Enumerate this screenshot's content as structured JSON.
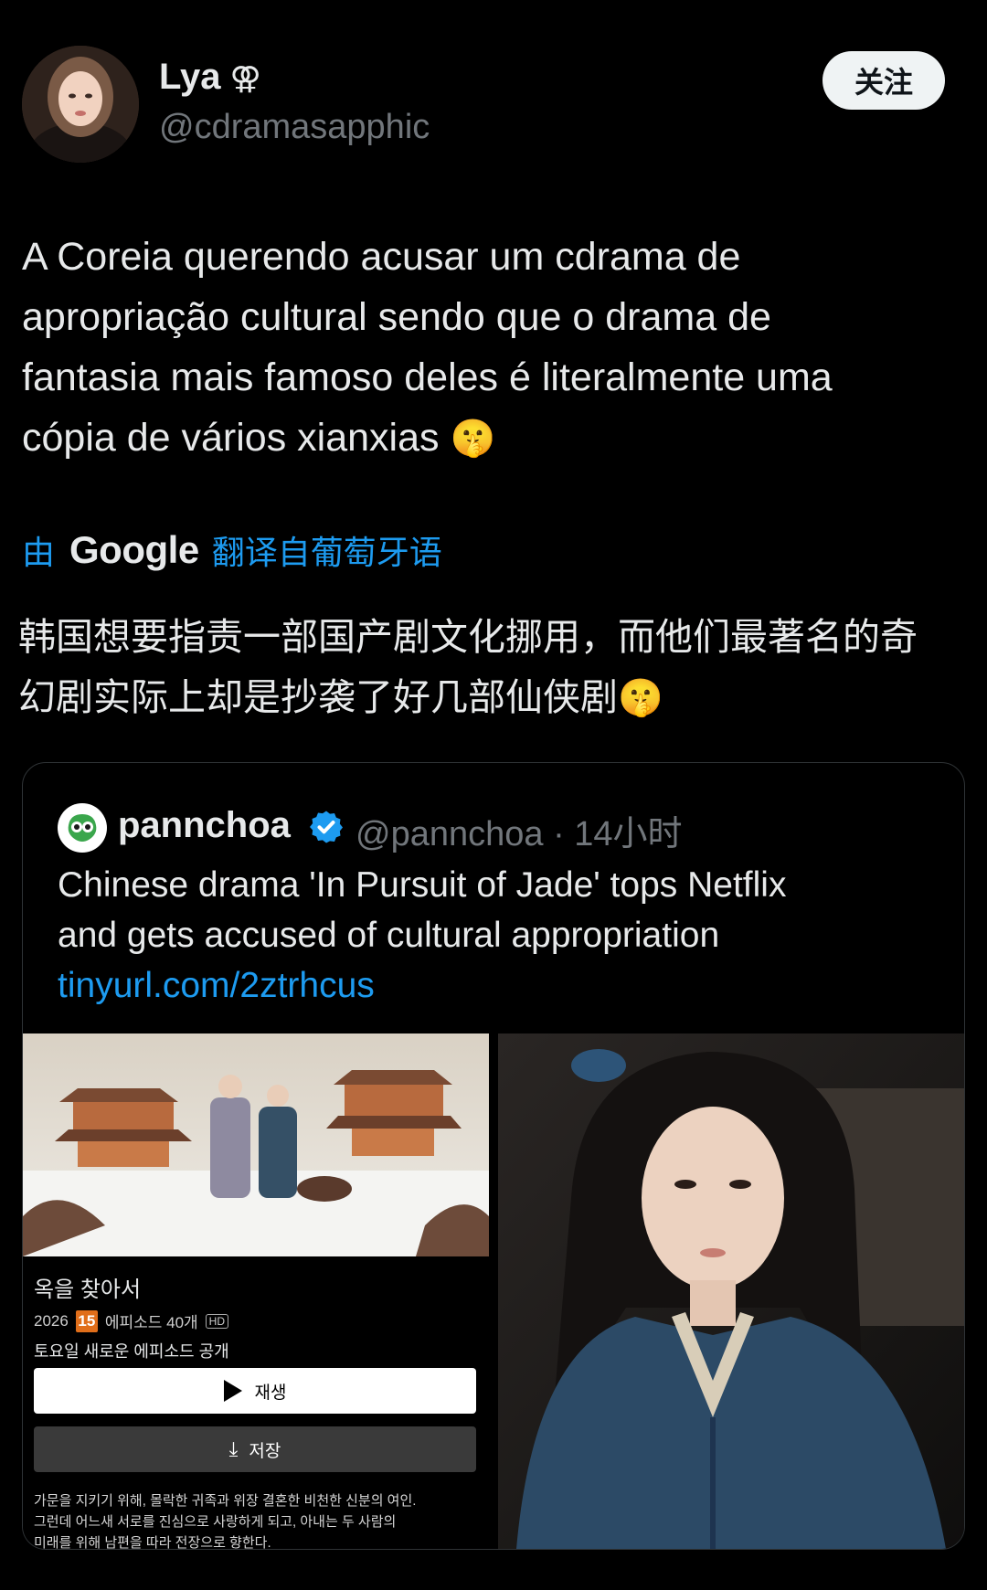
{
  "author": {
    "display_name": "Lya",
    "name_symbol": "⚢",
    "handle": "@cdramasapphic",
    "avatar": "profile-photo"
  },
  "follow_button": {
    "label": "关注"
  },
  "tweet": {
    "lines": [
      "A Coreia querendo acusar um cdrama de",
      "apropriação cultural sendo que o drama de",
      "fantasia mais famoso deles é literalmente uma",
      "cópia de vários xianxias"
    ],
    "emoji": "🤫"
  },
  "translation_bar": {
    "by": "由",
    "provider": "Google",
    "label": "翻译自葡萄牙语"
  },
  "translated": {
    "lines": [
      "韩国想要指责一部国产剧文化挪用，而他们最著名的奇",
      "幻剧实际上却是抄袭了好几部仙侠剧"
    ],
    "emoji": "🤫"
  },
  "quote": {
    "name": "pannchoa",
    "verified_icon": "verified-badge-icon",
    "handle_time": "@pannchoa · 14小时",
    "text_lines": [
      "Chinese drama 'In Pursuit of Jade' tops Netflix",
      "and gets accused of cultural appropriation"
    ],
    "link": "tinyurl.com/2ztrhcus",
    "media": {
      "left": {
        "title": "옥을 찾아서",
        "year": "2026",
        "age_rating": "15",
        "episodes": "에피소드 40개",
        "quality": "HD",
        "new_episodes": "토요일 새로운 에피소드 공개",
        "play_label": "재생",
        "save_label": "저장",
        "description_lines": [
          "가문을 지키기 위해, 몰락한 귀족과 위장 결혼한 비천한 신분의 여인.",
          "그런데 어느새 서로를 진심으로 사랑하게 되고, 아내는 두 사람의",
          "미래를 위해 남편을 따라 전장으로 향한다."
        ]
      }
    }
  },
  "colors": {
    "background": "#000000",
    "text": "#e7e9ea",
    "muted": "#71767b",
    "link": "#1d9bf0",
    "border": "#2f3336",
    "age_badge": "#e06e1a"
  }
}
